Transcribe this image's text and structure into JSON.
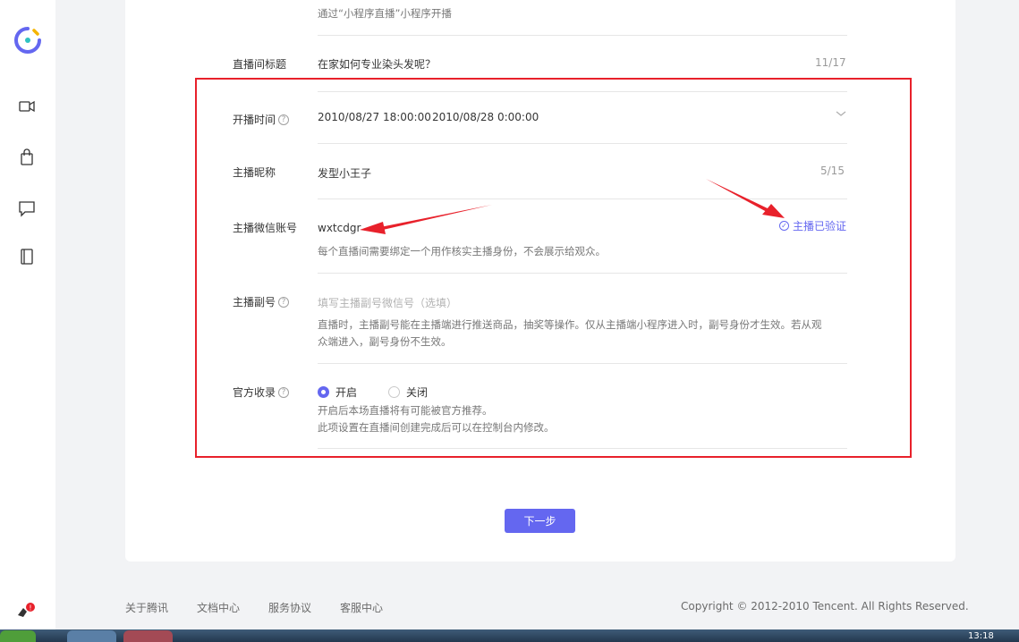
{
  "sidebar": {
    "logo_icon": "logo-icon",
    "items": [
      {
        "name": "live-video-icon"
      },
      {
        "name": "shopping-bag-icon"
      },
      {
        "name": "message-icon"
      },
      {
        "name": "book-icon"
      }
    ],
    "notice_icon": "notification-icon"
  },
  "form": {
    "method_hint": "通过“小程序直播”小程序开播",
    "title": {
      "label": "直播间标题",
      "value": "在家如何专业染头发呢？",
      "counter": "11/17"
    },
    "time": {
      "label": "开播时间",
      "start": "2010/08/27 18:00:00",
      "end": "2010/08/28 0:00:00"
    },
    "nickname": {
      "label": "主播昵称",
      "value": "发型小王子",
      "counter": "5/15"
    },
    "wechat": {
      "label": "主播微信账号",
      "value": "wxtcdgr",
      "tip": "每个直播间需要绑定一个用作核实主播身份，不会展示给观众。",
      "verified": "主播已验证"
    },
    "vice": {
      "label": "主播副号",
      "placeholder": "填写主播副号微信号（选填）",
      "tip_line1": "直播时，主播副号能在主播端进行推送商品，抽奖等操作。仅从主播端小程序进入时，副号身份才生效。若从观",
      "tip_line2": "众端进入，副号身份不生效。"
    },
    "official": {
      "label": "官方收录",
      "opt_on": "开启",
      "opt_off": "关闭",
      "selected": "开启",
      "tip_line1": "开启后本场直播将有可能被官方推荐。",
      "tip_line2": "此项设置在直播间创建完成后可以在控制台内修改。"
    }
  },
  "next_button": "下一步",
  "footer": {
    "links": [
      "关于腾讯",
      "文档中心",
      "服务协议",
      "客服中心"
    ],
    "copyright": "Copyright © 2012-2010 Tencent. All Rights Reserved."
  },
  "taskbar": {
    "clock": "13:18"
  },
  "colors": {
    "accent": "#6467f0",
    "annotation": "#e8212b"
  }
}
